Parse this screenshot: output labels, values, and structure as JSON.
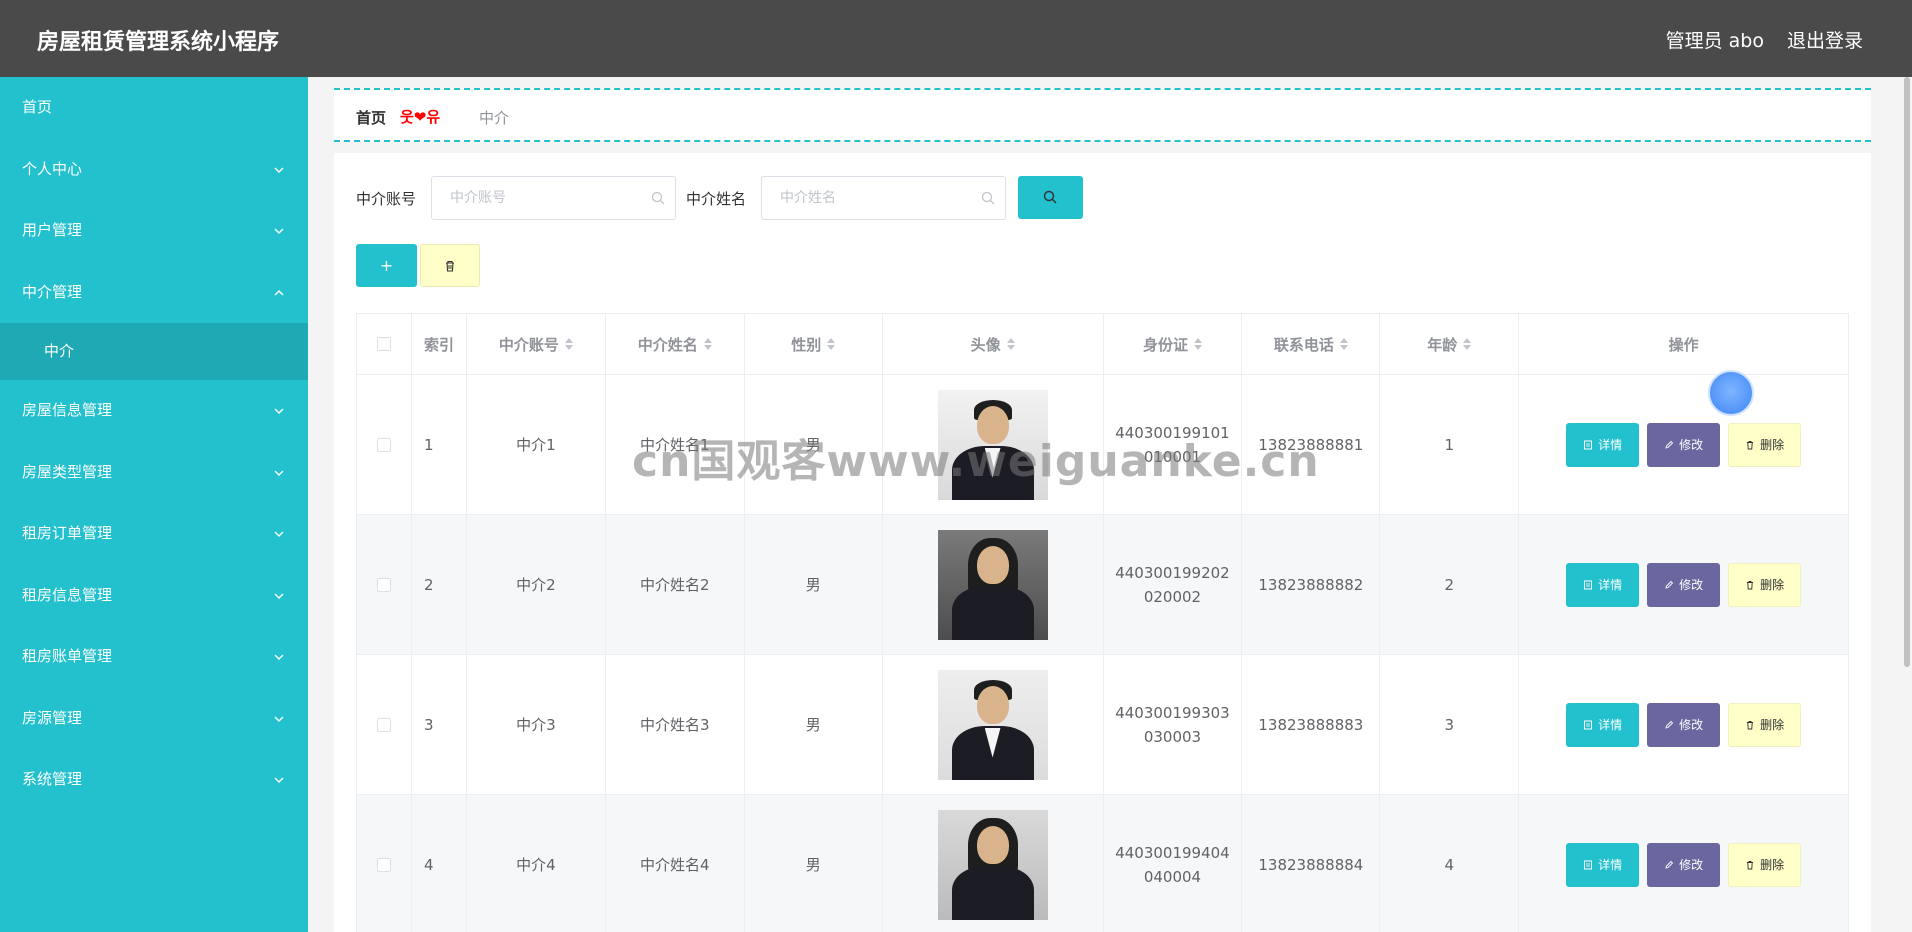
{
  "app": {
    "title": "房屋租赁管理系统小程序"
  },
  "header": {
    "user": "管理员 abo",
    "logout": "退出登录"
  },
  "sidebar": {
    "items": [
      {
        "label": "首页"
      },
      {
        "label": "个人中心"
      },
      {
        "label": "用户管理"
      },
      {
        "label": "中介管理"
      },
      {
        "label": "中介"
      },
      {
        "label": "房屋信息管理"
      },
      {
        "label": "房屋类型管理"
      },
      {
        "label": "租房订单管理"
      },
      {
        "label": "租房信息管理"
      },
      {
        "label": "租房账单管理"
      },
      {
        "label": "房源管理"
      },
      {
        "label": "系统管理"
      }
    ]
  },
  "breadcrumb": {
    "home": "首页",
    "separator": "웃❤유",
    "current": "中介"
  },
  "search": {
    "account_label": "中介账号",
    "account_placeholder": "中介账号",
    "name_label": "中介姓名",
    "name_placeholder": "中介姓名"
  },
  "toolbar": {
    "add_label": "+"
  },
  "table": {
    "headers": {
      "index": "索引",
      "account": "中介账号",
      "name": "中介姓名",
      "gender": "性别",
      "avatar": "头像",
      "idcard": "身份证",
      "phone": "联系电话",
      "age": "年龄",
      "ops": "操作"
    },
    "rows": [
      {
        "index": "1",
        "account": "中介1",
        "name": "中介姓名1",
        "gender": "男",
        "idcard": "440300199101010001",
        "phone": "13823888881",
        "age": "1"
      },
      {
        "index": "2",
        "account": "中介2",
        "name": "中介姓名2",
        "gender": "男",
        "idcard": "440300199202020002",
        "phone": "13823888882",
        "age": "2"
      },
      {
        "index": "3",
        "account": "中介3",
        "name": "中介姓名3",
        "gender": "男",
        "idcard": "440300199303030003",
        "phone": "13823888883",
        "age": "3"
      },
      {
        "index": "4",
        "account": "中介4",
        "name": "中介姓名4",
        "gender": "男",
        "idcard": "440300199404040004",
        "phone": "13823888884",
        "age": "4"
      }
    ],
    "ops": {
      "detail": "详情",
      "edit": "修改",
      "delete": "删除"
    }
  },
  "watermark": "cn国观客www.weiguanke.cn",
  "colors": {
    "accent": "#23c0cd",
    "header": "#4a4a4a",
    "edit": "#6a67a0",
    "delete": "#ffffc8"
  }
}
